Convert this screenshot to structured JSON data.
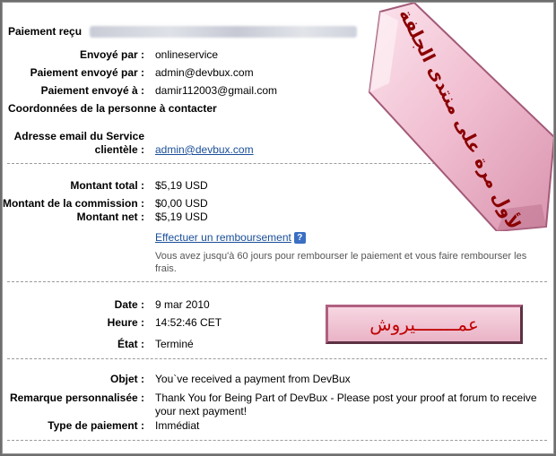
{
  "payment_received": {
    "label": "Paiement reçu"
  },
  "details": [
    {
      "label": "Envoyé par :",
      "value": "onlineservice"
    },
    {
      "label": "Paiement envoyé par :",
      "value": "admin@devbux.com"
    },
    {
      "label": "Paiement envoyé à :",
      "value": "damir112003@gmail.com"
    }
  ],
  "contact": {
    "heading": "Coordonnées de la personne à contacter",
    "label_line1": "Adresse email du Service",
    "label_line2": "clientèle :",
    "email": "admin@devbux.com"
  },
  "amounts": [
    {
      "label": "Montant total :",
      "value": "$5,19 USD"
    },
    {
      "label": "Montant de la commission :",
      "value": "$0,00 USD"
    },
    {
      "label": "Montant net :",
      "value": "$5,19 USD"
    }
  ],
  "refund": {
    "link": "Effectuer un remboursement",
    "help": "?",
    "note": "Vous avez jusqu'à 60 jours pour rembourser le paiement et vous faire rembourser les frais."
  },
  "status": [
    {
      "label": "Date :",
      "value": "9 mar 2010"
    },
    {
      "label": "Heure :",
      "value": "14:52:46 CET"
    },
    {
      "label": "État :",
      "value": "Terminé"
    }
  ],
  "message": [
    {
      "label": "Objet :",
      "value": "You`ve received a payment from DevBux"
    },
    {
      "label": "Remarque personnalisée :",
      "value": "Thank You for Being Part of DevBux - Please post your proof at forum to receive your next payment!"
    },
    {
      "label": "Type de paiement :",
      "value": "Immédiat"
    }
  ],
  "overlays": {
    "stamp_top_right": "لأول مرة على منتدى الجلفة",
    "stamp_name": "عمــــــــيروش"
  },
  "colors": {
    "link": "#1a4e99",
    "stamp_pink": "#f3c4d4",
    "stamp_text": "#8a0000"
  }
}
